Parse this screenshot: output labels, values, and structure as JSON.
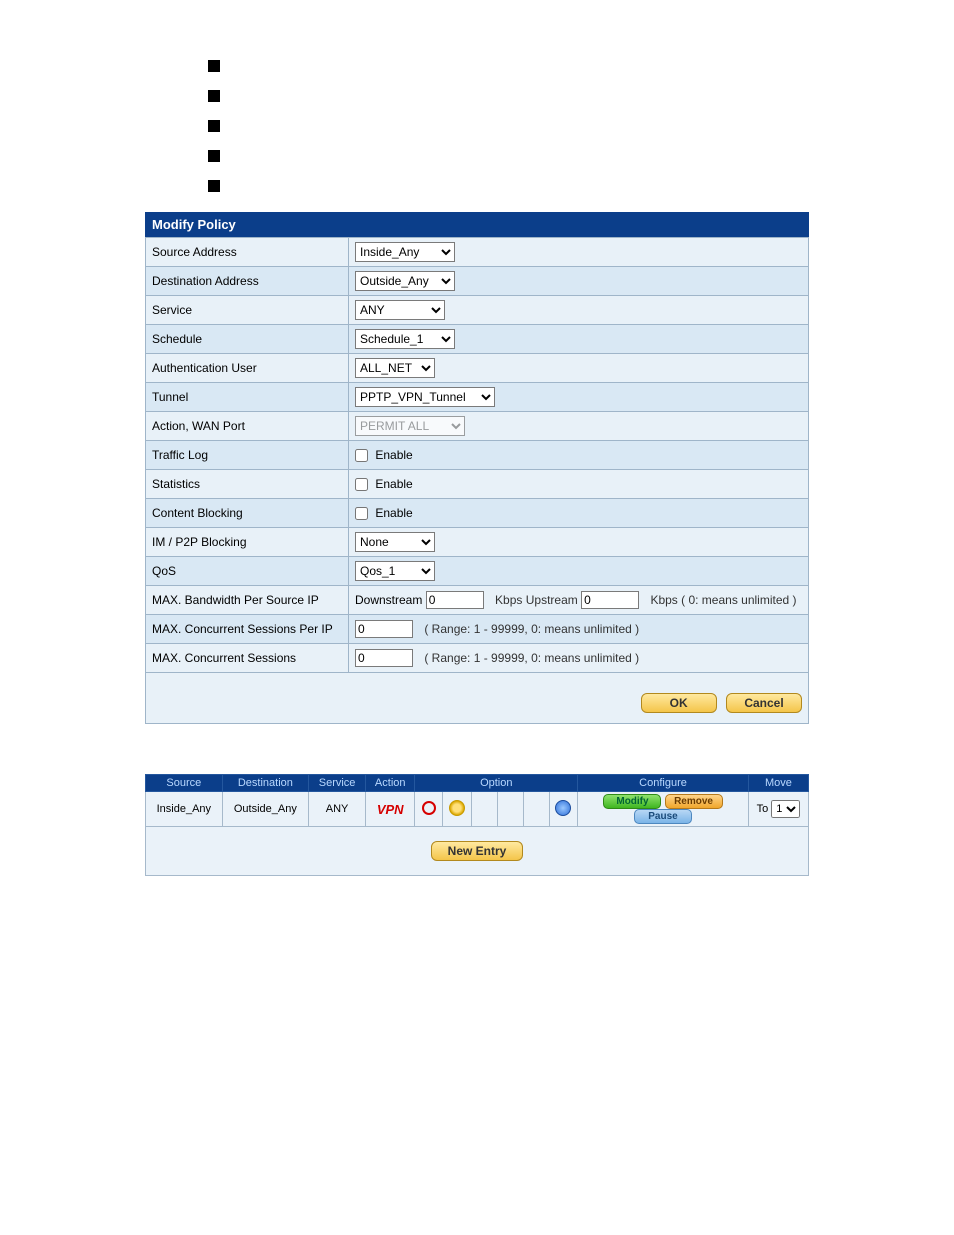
{
  "header": {
    "title": "Modify Policy"
  },
  "form": {
    "sourceAddress": {
      "label": "Source Address",
      "value": "Inside_Any"
    },
    "destinationAddress": {
      "label": "Destination Address",
      "value": "Outside_Any"
    },
    "service": {
      "label": "Service",
      "value": "ANY"
    },
    "schedule": {
      "label": "Schedule",
      "value": "Schedule_1"
    },
    "authUser": {
      "label": "Authentication User",
      "value": "ALL_NET"
    },
    "tunnel": {
      "label": "Tunnel",
      "value": "PPTP_VPN_Tunnel"
    },
    "actionWan": {
      "label": "Action, WAN Port",
      "value": "PERMIT ALL"
    },
    "trafficLog": {
      "label": "Traffic Log",
      "enableLabel": "Enable",
      "checked": false
    },
    "statistics": {
      "label": "Statistics",
      "enableLabel": "Enable",
      "checked": false
    },
    "contentBlocking": {
      "label": "Content Blocking",
      "enableLabel": "Enable",
      "checked": false
    },
    "imp2p": {
      "label": "IM / P2P Blocking",
      "value": "None"
    },
    "qos": {
      "label": "QoS",
      "value": "Qos_1"
    },
    "maxBwPerIp": {
      "label": "MAX. Bandwidth Per Source IP",
      "downLabel": "Downstream",
      "downValue": "0",
      "midLabel": "Kbps Upstream",
      "upValue": "0",
      "tail": "Kbps ( 0: means unlimited )"
    },
    "maxSessPerIp": {
      "label": "MAX. Concurrent Sessions Per IP",
      "value": "0",
      "hint": "( Range: 1 - 99999, 0: means unlimited )"
    },
    "maxSess": {
      "label": "MAX. Concurrent Sessions",
      "value": "0",
      "hint": "( Range: 1 - 99999, 0: means unlimited )"
    }
  },
  "buttons": {
    "ok": "OK",
    "cancel": "Cancel"
  },
  "list": {
    "headers": {
      "source": "Source",
      "destination": "Destination",
      "service": "Service",
      "action": "Action",
      "option": "Option",
      "configure": "Configure",
      "move": "Move"
    },
    "row": {
      "source": "Inside_Any",
      "destination": "Outside_Any",
      "service": "ANY",
      "action": "VPN",
      "modify": "Modify",
      "remove": "Remove",
      "pause": "Pause",
      "toLabel": "To",
      "toValue": "1"
    },
    "newEntry": "New Entry"
  }
}
